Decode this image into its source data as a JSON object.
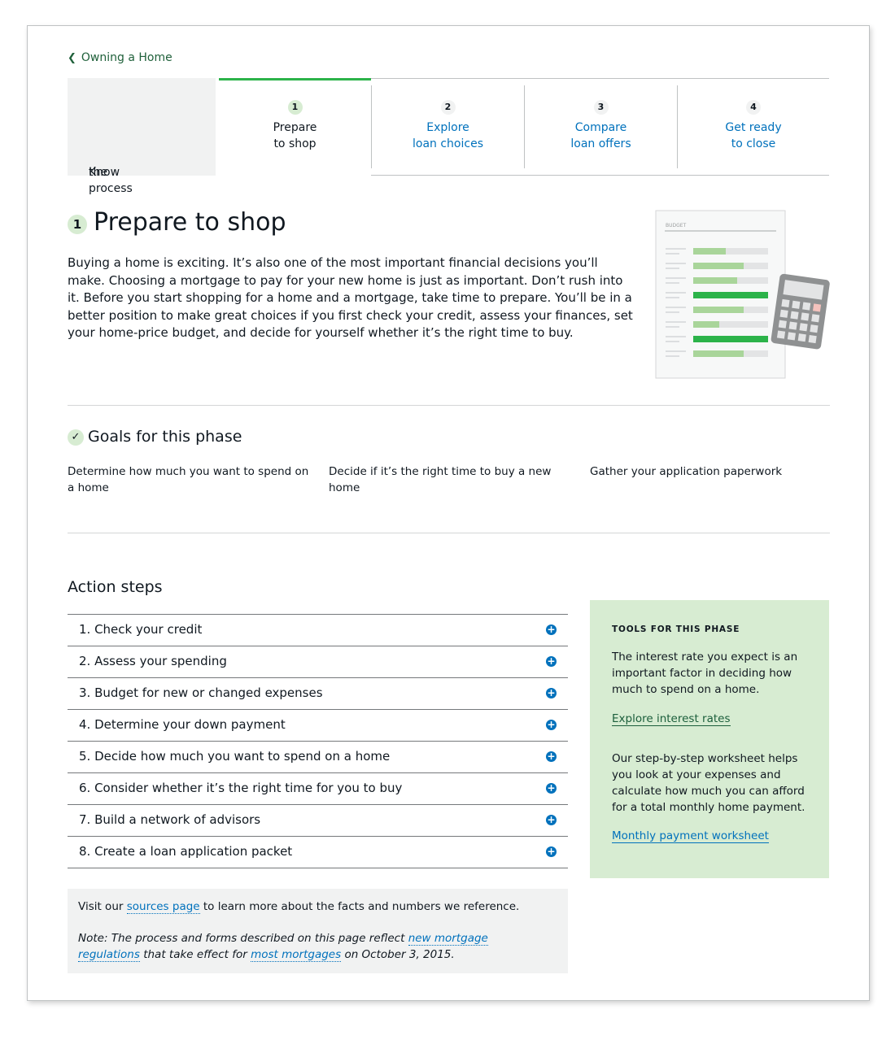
{
  "back": {
    "label": "Owning a Home"
  },
  "tabs": [
    {
      "label_lines": [
        "Know",
        "the process"
      ]
    },
    {
      "num": "1",
      "label_lines": [
        "Prepare",
        "to shop"
      ]
    },
    {
      "num": "2",
      "label_lines": [
        "Explore",
        "loan choices"
      ]
    },
    {
      "num": "3",
      "label_lines": [
        "Compare",
        "loan offers"
      ]
    },
    {
      "num": "4",
      "label_lines": [
        "Get ready",
        "to close"
      ]
    }
  ],
  "heading": {
    "num": "1",
    "title": "Prepare to shop"
  },
  "intro": "Buying a home is exciting. It’s also one of the most important financial decisions you’ll make. Choosing a mortgage to pay for your new home is just as important. Don’t rush into it. Before you start shopping for a home and a mortgage, take time to prepare. You’ll be in a better position to make great choices if you first check your credit, assess your finances, set your home-price budget, and decide for yourself whether it’s the right time to buy.",
  "illustration": {
    "label": "BUDGET"
  },
  "goals": {
    "title": "Goals for this phase",
    "items": [
      "Determine how much you want to spend on a home",
      "Decide if it’s the right time to buy a new home",
      "Gather your application paperwork"
    ]
  },
  "action_steps": {
    "title": "Action steps",
    "items": [
      "1. Check your credit",
      "2. Assess your spending",
      "3. Budget for new or changed expenses",
      "4. Determine your down payment",
      "5. Decide how much you want to spend on a home",
      "6. Consider whether it’s the right time for you to buy",
      "7. Build a network of advisors",
      "8. Create a loan application packet"
    ]
  },
  "tools": {
    "caption": "TOOLS FOR THIS PHASE",
    "text1": "The interest rate you expect is an important factor in deciding how much to spend on a home.",
    "link1": "Explore interest rates",
    "text2": "Our step-by-step worksheet helps you look at your expenses and calculate how much you can afford for a total monthly home payment.",
    "link2": "Monthly payment worksheet"
  },
  "note": {
    "l1_pre": "Visit our ",
    "l1_link": "sources page",
    "l1_post": " to learn more about the facts and numbers we reference.",
    "l2_pre": "Note: The process and forms described on this page reflect ",
    "l2_link1": "new mortgage regulations",
    "l2_mid": " that take effect for ",
    "l2_link2": "most mortgages",
    "l2_post": " on October 3, 2015."
  },
  "colors": {
    "accent_green": "#2cb34a",
    "light_green": "#d7ecd2",
    "link_blue": "#0071bc",
    "dark_green": "#20613b"
  }
}
